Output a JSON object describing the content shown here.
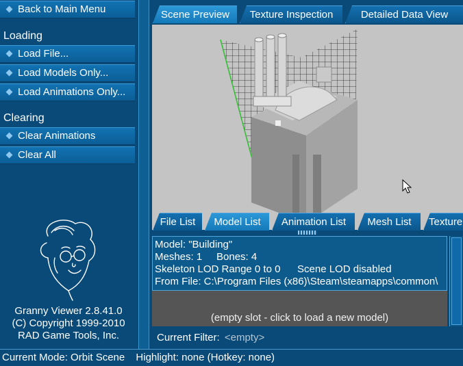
{
  "left_panel": {
    "back_button": "Back to Main Menu",
    "loading_label": "Loading",
    "loading_items": [
      "Load File...",
      "Load Models Only...",
      "Load Animations Only..."
    ],
    "clearing_label": "Clearing",
    "clearing_items": [
      "Clear Animations",
      "Clear All"
    ],
    "info": [
      "Granny Viewer 2.8.41.0",
      "(C) Copyright 1999-2010",
      "RAD Game Tools, Inc."
    ]
  },
  "top_tabs": {
    "items": [
      "Scene Preview",
      "Texture Inspection",
      "Detailed Data View"
    ],
    "active": "Scene Preview"
  },
  "bottom_tabs": {
    "items": [
      "File List",
      "Model List",
      "Animation List",
      "Mesh List",
      "Texture"
    ],
    "active": "Model List"
  },
  "model_info": {
    "model": "Model: \"Building\"",
    "meshes": "Meshes: 1",
    "bones": "Bones: 4",
    "lod_range": "Skeleton LOD Range 0 to 0",
    "scene_lod": "Scene LOD disabled",
    "from_file": "From File: C:\\Program Files (x86)\\Steam\\steamapps\\common\\"
  },
  "empty_slot": "(empty slot - click to load a new model)",
  "filter": {
    "label": "Current Filter:",
    "value": "<empty>"
  },
  "status_bar": {
    "mode": "Current Mode: Orbit Scene",
    "highlight": "Highlight: none (Hotkey: none)"
  },
  "icons": {
    "bullet": "diamond-bullet-icon",
    "mascot": "granny-mascot",
    "cursor": "mouse-pointer"
  },
  "colors": {
    "panel_background": "#0a4a78",
    "button": "#0b5e96",
    "active_tab": "#1c88c8",
    "viewport": "#c4c4c4",
    "empty_slot": "#555556"
  }
}
